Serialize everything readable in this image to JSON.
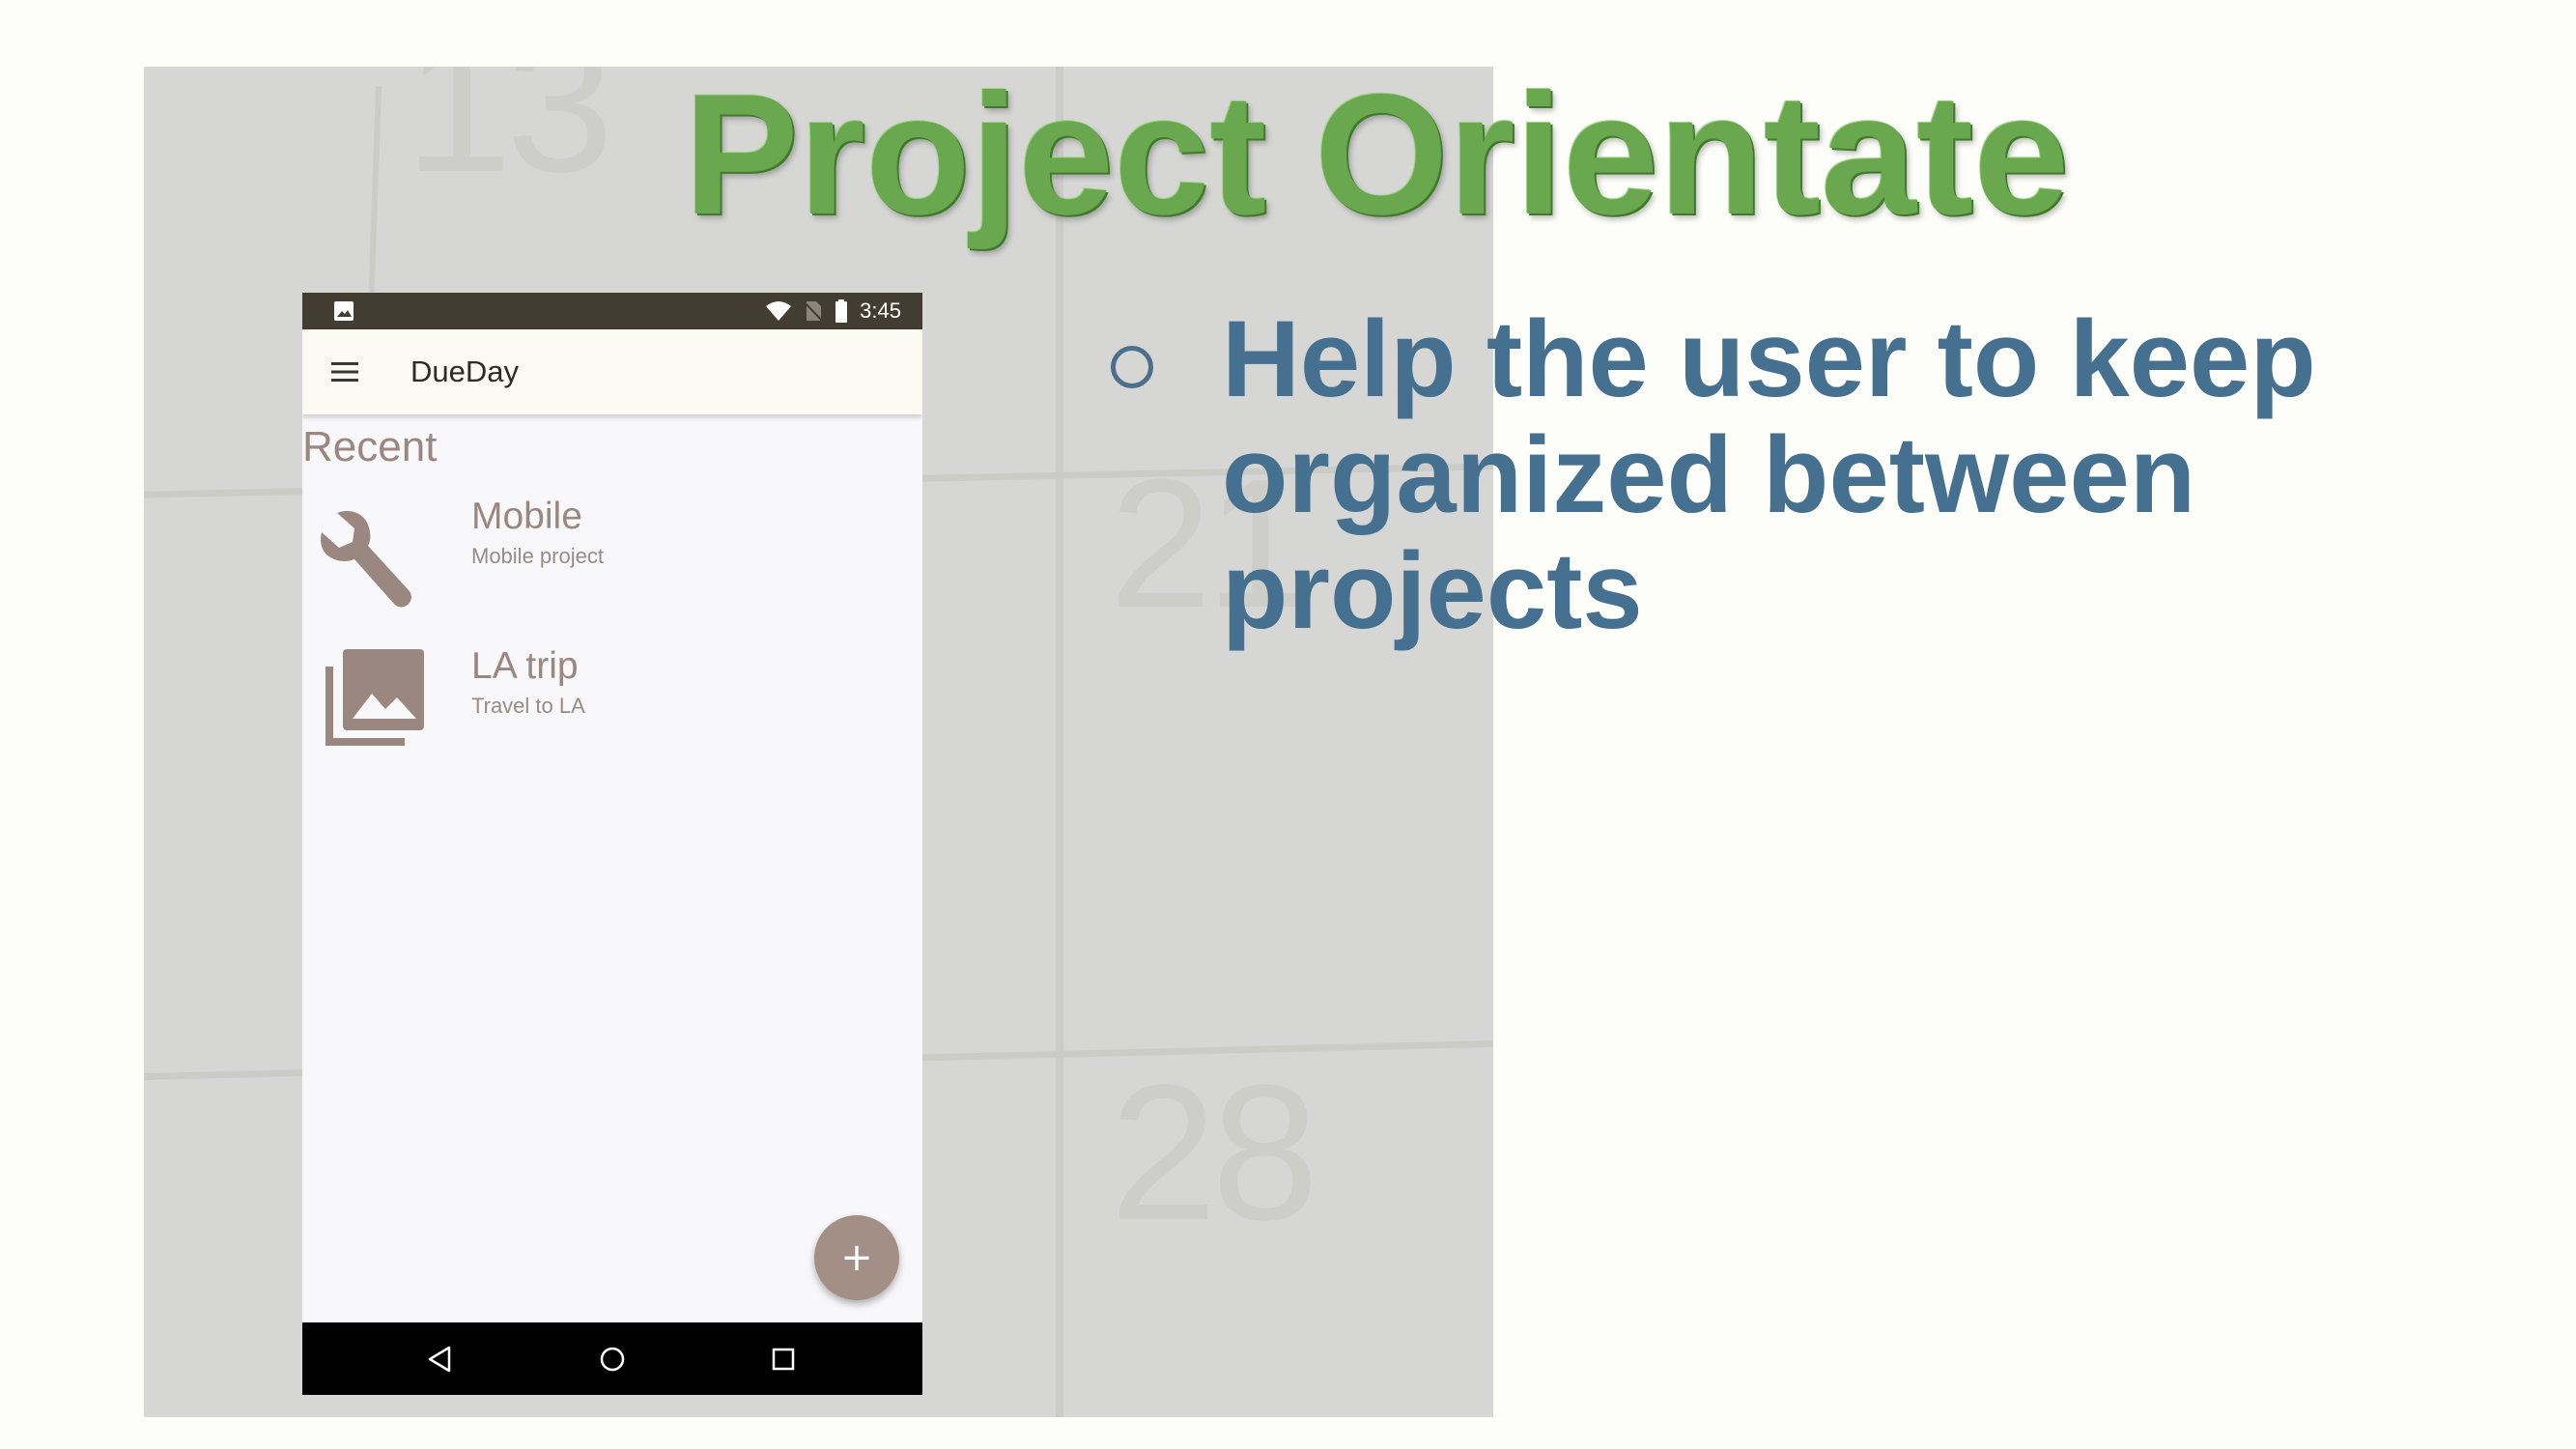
{
  "slide": {
    "title": "Project Orientate",
    "bullet": "Help the user to keep organized between projects",
    "background_numbers": [
      "13",
      "21",
      "28"
    ]
  },
  "phone": {
    "statusbar": {
      "time": "3:45",
      "left_icon": "image-notification-icon",
      "icons": [
        "wifi-icon",
        "no-sim-icon",
        "battery-icon"
      ]
    },
    "appbar": {
      "title": "DueDay",
      "menu_icon": "hamburger-menu-icon"
    },
    "section_header": "Recent",
    "items": [
      {
        "title": "Mobile",
        "subtitle": "Mobile project",
        "icon": "wrench-icon"
      },
      {
        "title": "LA trip",
        "subtitle": "Travel to LA",
        "icon": "photo-library-icon"
      }
    ],
    "fab": {
      "label": "+",
      "icon": "add-icon"
    },
    "navbar": {
      "icons": [
        "back-icon",
        "home-icon",
        "recents-icon"
      ]
    }
  },
  "colors": {
    "title_green": "#6aa84f",
    "bullet_blue": "#45708f",
    "accent_taupe": "#a48f86",
    "statusbar": "#423c31"
  }
}
